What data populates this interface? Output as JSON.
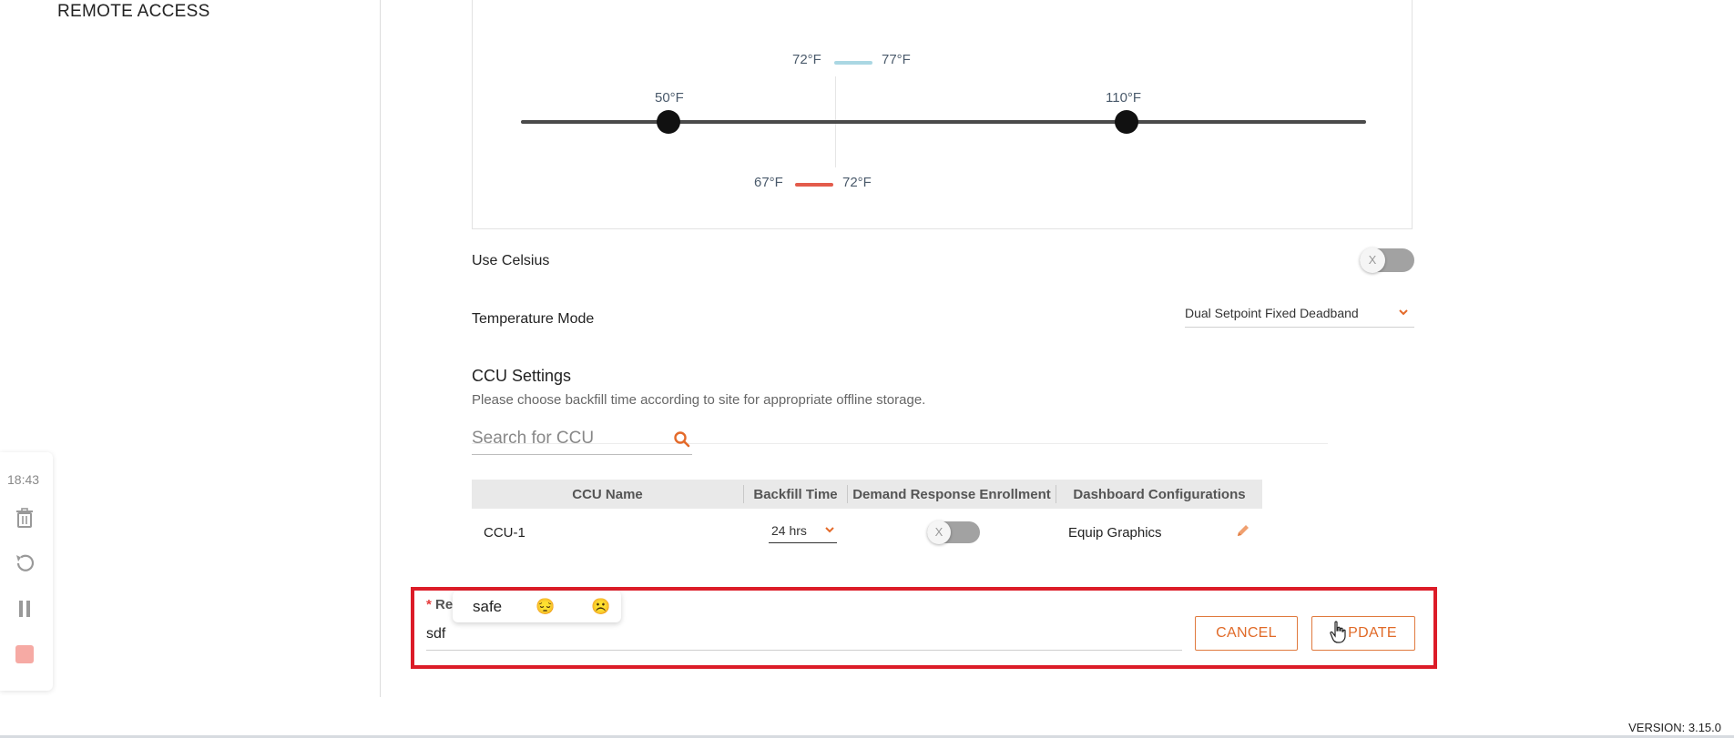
{
  "sidebar": {
    "title": "REMOTE ACCESS"
  },
  "range": {
    "min_thumb_label": "50°F",
    "max_thumb_label": "110°F",
    "cooling_low": "72°F",
    "cooling_high": "77°F",
    "heating_low": "67°F",
    "heating_high": "72°F"
  },
  "settings": {
    "use_celsius_label": "Use Celsius",
    "use_celsius_toggle": "X",
    "temperature_mode_label": "Temperature Mode",
    "temperature_mode_value": "Dual Setpoint Fixed Deadband"
  },
  "ccu": {
    "title": "CCU Settings",
    "subtitle": "Please choose backfill time according to site for appropriate offline storage.",
    "search_placeholder": "Search for CCU",
    "columns": [
      "CCU Name",
      "Backfill Time",
      "Demand Response Enrollment",
      "Dashboard Configurations"
    ],
    "rows": [
      {
        "name": "CCU-1",
        "backfill": "24 hrs",
        "demand_toggle": "X",
        "dashboard": "Equip Graphics"
      }
    ]
  },
  "form": {
    "reason_label_visible": "Re",
    "reason_required_mark": "*",
    "reason_value": "sdf",
    "suggestions": [
      "safe",
      "😔",
      "☹️"
    ],
    "cancel_label": "CANCEL",
    "update_label": "PDATE"
  },
  "left_toolbar": {
    "time": "18:43"
  },
  "footer": {
    "version": "VERSION: 3.15.0"
  },
  "colors": {
    "accent": "#e06a28",
    "highlight": "#dc1c28",
    "cooling": "#aad7e3",
    "heating": "#e35b4b"
  }
}
